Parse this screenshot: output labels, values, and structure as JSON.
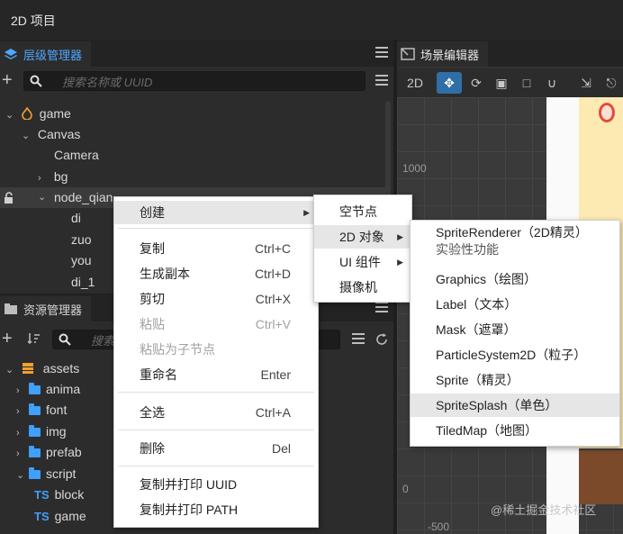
{
  "window": {
    "title": "2D 项目"
  },
  "hierarchy": {
    "tab_label": "层级管理器",
    "search_placeholder": "搜索名称或 UUID",
    "nodes": [
      {
        "label": "game"
      },
      {
        "label": "Canvas"
      },
      {
        "label": "Camera"
      },
      {
        "label": "bg"
      },
      {
        "label": "node_qian"
      },
      {
        "label": "di"
      },
      {
        "label": "zuo"
      },
      {
        "label": "you"
      },
      {
        "label": "di_1"
      }
    ]
  },
  "assets": {
    "tab_label": "资源管理器",
    "search_placeholder": "搜索",
    "items": [
      {
        "label": "assets"
      },
      {
        "label": "anima"
      },
      {
        "label": "font"
      },
      {
        "label": "img"
      },
      {
        "label": "prefab"
      },
      {
        "label": "script"
      },
      {
        "label": "block",
        "badge": "TS"
      },
      {
        "label": "game",
        "badge": "TS"
      }
    ]
  },
  "scene": {
    "tab_label": "场景编辑器",
    "mode": "2D",
    "axis_labels": {
      "y_top": "1000",
      "y_zero": "0",
      "x_left": "-500"
    }
  },
  "context_menu": {
    "items": [
      {
        "label": "创建",
        "shortcut": ""
      },
      {
        "label": "复制",
        "shortcut": "Ctrl+C"
      },
      {
        "label": "生成副本",
        "shortcut": "Ctrl+D"
      },
      {
        "label": "剪切",
        "shortcut": "Ctrl+X"
      },
      {
        "label": "粘贴",
        "shortcut": "Ctrl+V"
      },
      {
        "label": "粘贴为子节点",
        "shortcut": ""
      },
      {
        "label": "重命名",
        "shortcut": "Enter"
      },
      {
        "label": "全选",
        "shortcut": "Ctrl+A"
      },
      {
        "label": "删除",
        "shortcut": "Del"
      },
      {
        "label": "复制并打印 UUID",
        "shortcut": ""
      },
      {
        "label": "复制并打印 PATH",
        "shortcut": ""
      }
    ]
  },
  "create_submenu": {
    "items": [
      {
        "label": "空节点"
      },
      {
        "label": "2D 对象"
      },
      {
        "label": "UI 组件"
      },
      {
        "label": "摄像机"
      }
    ]
  },
  "object2d_submenu": {
    "items": [
      {
        "label": "SpriteRenderer（2D精灵）",
        "sub": "实验性功能"
      },
      {
        "label": "Graphics（绘图）"
      },
      {
        "label": "Label（文本）"
      },
      {
        "label": "Mask（遮罩）"
      },
      {
        "label": "ParticleSystem2D（粒子）"
      },
      {
        "label": "Sprite（精灵）"
      },
      {
        "label": "SpriteSplash（单色）"
      },
      {
        "label": "TiledMap（地图）"
      }
    ]
  },
  "watermark": "@稀土掘金技术社区",
  "colors": {
    "accent": "#4fa8ff",
    "active_tool": "#2e6fa8",
    "menu_bg": "#ffffff",
    "menu_highlight": "#e6e6e6"
  }
}
